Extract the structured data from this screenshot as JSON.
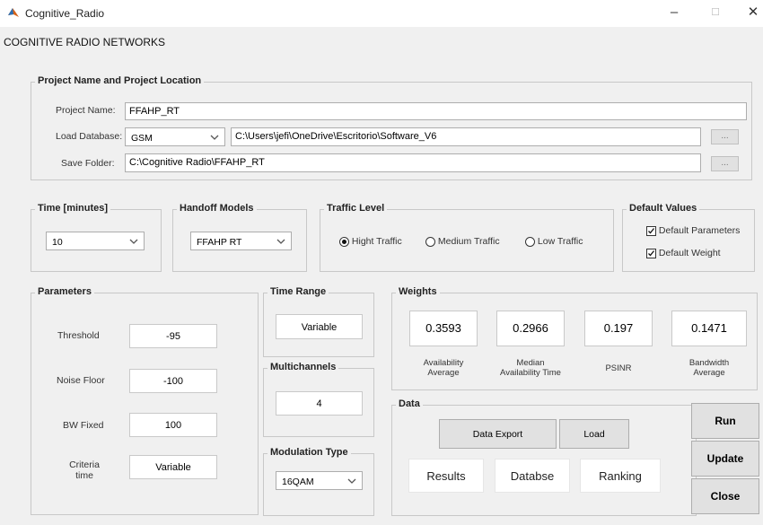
{
  "window": {
    "title": "Cognitive_Radio",
    "minimize_glyph": "–",
    "maximize_glyph": "☐",
    "close_glyph": "✕"
  },
  "menu_label": "COGNITIVE RADIO NETWORKS",
  "project": {
    "legend": "Project Name and Project Location",
    "name_label": "Project Name:",
    "name_value": "FFAHP_RT",
    "database_label": "Load Database:",
    "database_option": "GSM",
    "database_path": "C:\\Users\\jefi\\OneDrive\\Escritorio\\Software_V6",
    "save_label": "Save Folder:",
    "save_path": "C:\\Cognitive Radio\\FFAHP_RT",
    "browse_label": "..."
  },
  "time": {
    "legend": "Time [minutes]",
    "value": "10"
  },
  "handoff": {
    "legend": "Handoff Models",
    "value": "FFAHP RT"
  },
  "traffic": {
    "legend": "Traffic Level",
    "options": [
      "Hight Traffic",
      "Medium Traffic",
      "Low Traffic"
    ],
    "selected": "Hight Traffic"
  },
  "defaults": {
    "legend": "Default Values",
    "parameters_label": "Default Parameters",
    "weight_label": "Default Weight",
    "parameters_checked": true,
    "weight_checked": true
  },
  "parameters": {
    "legend": "Parameters",
    "rows": [
      {
        "label": "Threshold",
        "value": "-95"
      },
      {
        "label": "Noise Floor",
        "value": "-100"
      },
      {
        "label": "BW Fixed",
        "value": "100"
      },
      {
        "label": "Criteria\ntime",
        "value": "Variable"
      }
    ]
  },
  "time_range": {
    "legend": "Time Range",
    "value": "Variable"
  },
  "multichannels": {
    "legend": "Multichannels",
    "value": "4"
  },
  "modulation": {
    "legend": "Modulation Type",
    "value": "16QAM"
  },
  "weights": {
    "legend": "Weights",
    "items": [
      {
        "value": "0.3593",
        "caption": "Availability\nAverage"
      },
      {
        "value": "0.2966",
        "caption": "Median\nAvailability Time"
      },
      {
        "value": "0.197",
        "caption": "PSINR"
      },
      {
        "value": "0.1471",
        "caption": "Bandwidth\nAverage"
      }
    ]
  },
  "data_panel": {
    "legend": "Data",
    "export_label": "Data Export",
    "load_label": "Load",
    "results_label": "Results",
    "database_label": "Databse",
    "ranking_label": "Ranking"
  },
  "actions": {
    "run_label": "Run",
    "update_label": "Update",
    "close_label": "Close"
  },
  "colors": {
    "window_bg": "#f0f0f0",
    "titlebar_bg": "#ffffff",
    "border": "#c8c8c8",
    "button_bg": "#e1e1e1"
  }
}
